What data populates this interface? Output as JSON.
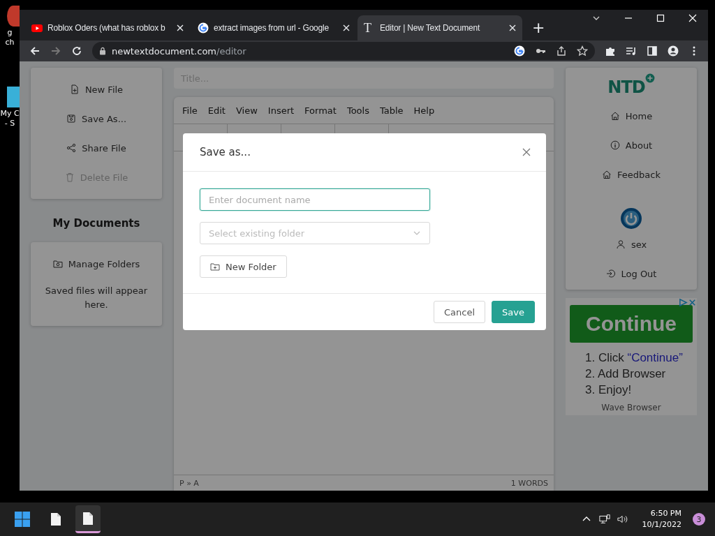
{
  "desktop_icons": [
    {
      "lines": [
        "g",
        "ch"
      ]
    },
    {
      "lines": [
        "My C",
        "- S"
      ]
    }
  ],
  "browser": {
    "tabs": [
      {
        "kind": "youtube",
        "title": "Roblox Oders (what has roblox b",
        "selected": false
      },
      {
        "kind": "google",
        "title": "extract images from url - Google",
        "selected": false
      },
      {
        "kind": "letter",
        "icon_text": "T",
        "title": "Editor | New Text Document",
        "selected": true
      }
    ],
    "new_tab": "+",
    "address": {
      "host": "newtextdocument.com",
      "path": "/editor"
    }
  },
  "left_menu": [
    {
      "kind": "new",
      "label": "New File",
      "disabled": false
    },
    {
      "kind": "save",
      "label": "Save As...",
      "disabled": false
    },
    {
      "kind": "share",
      "label": "Share File",
      "disabled": false
    },
    {
      "kind": "delete",
      "label": "Delete File",
      "disabled": true
    }
  ],
  "documents": {
    "heading": "My Documents",
    "manage": "Manage Folders",
    "empty": "Saved files will appear here."
  },
  "editor": {
    "title_placeholder": "Title...",
    "menu": [
      "File",
      "Edit",
      "View",
      "Insert",
      "Format",
      "Tools",
      "Table",
      "Help"
    ],
    "path": "P » A",
    "word_count": "1 WORDS"
  },
  "right_nav": {
    "logo": "NTD",
    "items": [
      {
        "kind": "home",
        "label": "Home"
      },
      {
        "kind": "info",
        "label": "About"
      },
      {
        "kind": "home",
        "label": "Feedback"
      }
    ],
    "user": "sex",
    "logout": "Log Out"
  },
  "ad": {
    "button": "Continue",
    "steps": [
      {
        "text": "1. Click ",
        "link": "“Continue”"
      },
      {
        "text": "2. Add Browser"
      },
      {
        "text": "3. Enjoy!"
      }
    ],
    "footer": "Wave Browser"
  },
  "modal": {
    "title": "Save as...",
    "name_placeholder": "Enter document name",
    "folder_placeholder": "Select existing folder",
    "new_folder": "New Folder",
    "cancel": "Cancel",
    "save": "Save"
  },
  "taskbar": {
    "apps": [
      {
        "kind": "file",
        "selected": false
      },
      {
        "kind": "file",
        "selected": true
      }
    ],
    "time": "6:50 PM",
    "date": "10/1/2022",
    "notifications": "3"
  }
}
